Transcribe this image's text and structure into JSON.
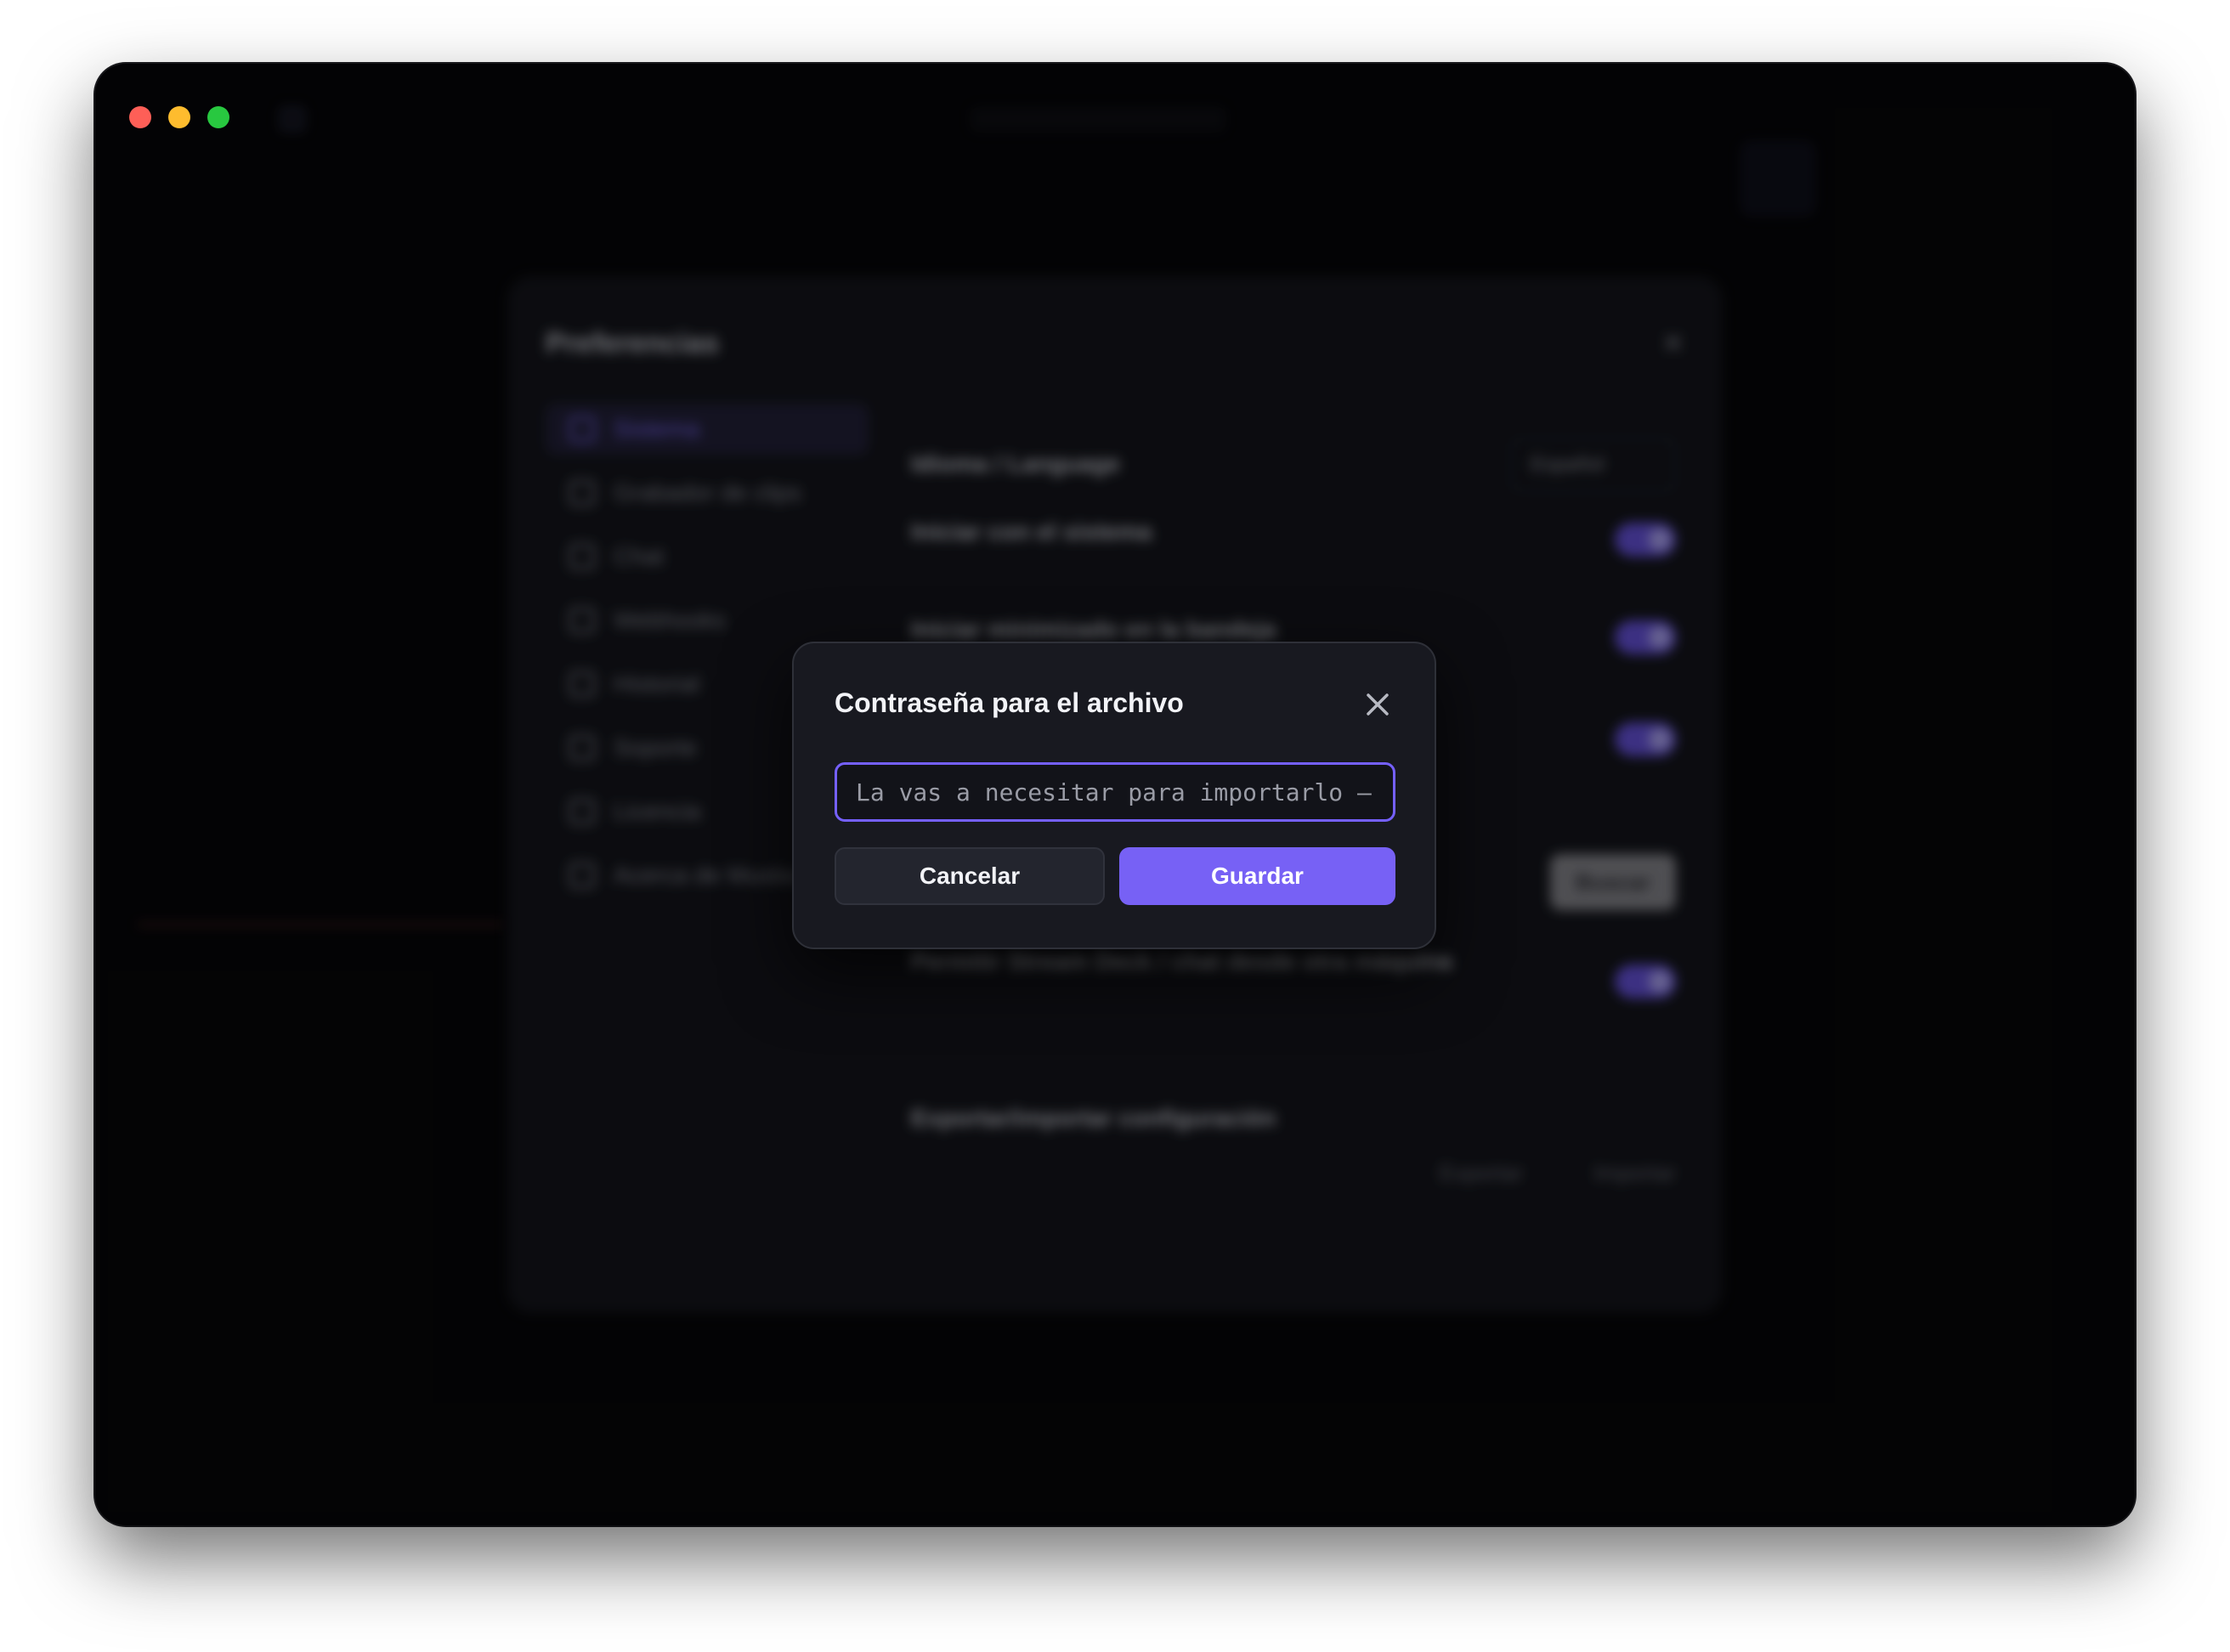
{
  "window": {
    "traffic_lights": {
      "close": "#fe5f57",
      "minimize": "#febc2e",
      "maximize": "#28c840"
    }
  },
  "preferences": {
    "title": "Preferencias",
    "sidebar": [
      {
        "label": "Sistema",
        "active": true
      },
      {
        "label": "Grabador de clips"
      },
      {
        "label": "Chat"
      },
      {
        "label": "Webhooks"
      },
      {
        "label": "Historial"
      },
      {
        "label": "Soporte"
      },
      {
        "label": "Licencia"
      },
      {
        "label": "Acerca de Mustia"
      }
    ],
    "language_label": "Idioma / Language",
    "language_value": "Español",
    "start_with_system": "Iniciar con el sistema",
    "start_minimized": "Iniciar minimizado en la bandeja",
    "search_button": "Buscar",
    "stream_deck_title": "Permitir Stream Deck / chat desde otra máquina",
    "export_import_title": "Exportar/importar configuración",
    "export_link": "Exportar",
    "import_link": "Importar"
  },
  "dialog": {
    "title": "Contraseña para el archivo",
    "password_placeholder": "La vas a necesitar para importarlo — anotala",
    "cancel_label": "Cancelar",
    "save_label": "Guardar",
    "accent_color": "#7761f5"
  }
}
